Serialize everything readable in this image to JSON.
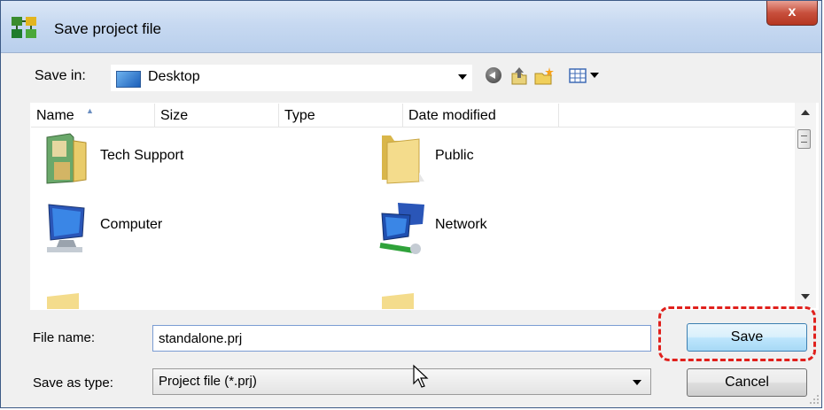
{
  "window": {
    "title": "Save project file",
    "close_glyph": "x"
  },
  "toolbar": {
    "save_in_label": "Save in:",
    "save_in_value": "Desktop",
    "icons": [
      "back-icon",
      "up-folder-icon",
      "new-folder-icon",
      "views-menu-icon"
    ]
  },
  "filelist": {
    "columns": [
      "Name",
      "Size",
      "Type",
      "Date modified"
    ],
    "sorted_column": "Name",
    "items": [
      {
        "name": "Tech Support",
        "icon": "user-folder-icon"
      },
      {
        "name": "Public",
        "icon": "folder-icon"
      },
      {
        "name": "Computer",
        "icon": "computer-icon"
      },
      {
        "name": "Network",
        "icon": "network-icon"
      }
    ]
  },
  "form": {
    "file_name_label": "File name:",
    "file_name_value": "standalone.prj",
    "save_as_type_label": "Save as type:",
    "save_as_type_value": "Project file (*.prj)"
  },
  "buttons": {
    "save": "Save",
    "cancel": "Cancel"
  },
  "colors": {
    "highlight": "#e0201c",
    "title_bar": "#c7d9f1",
    "close_button": "#c8503d"
  }
}
